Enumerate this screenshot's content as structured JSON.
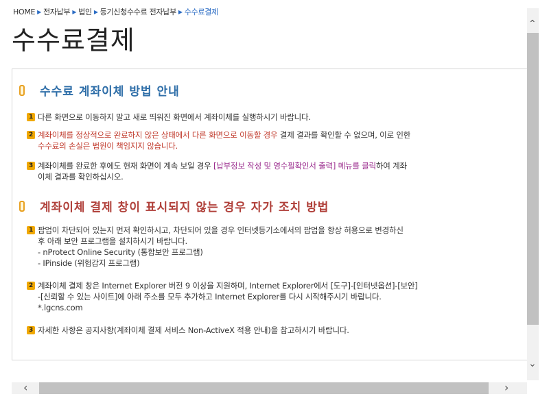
{
  "breadcrumb": {
    "items": [
      "HOME",
      "전자납부",
      "법인",
      "등기신청수수료 전자납부"
    ],
    "current": "수수료결제"
  },
  "page_title": "수수료결제",
  "section1": {
    "heading": "수수료 계좌이체 방법 안내",
    "items": [
      {
        "num": "1",
        "text": "다른 화면으로 이동하지 말고 새로 띄워진 화면에서 계좌이체를 실행하시기 바랍니다."
      },
      {
        "num": "2",
        "red": "계좌이체를 정상적으로 완료하지 않은 상태에서 다른 화면으로 이동할 경우",
        "text_mid": " 결제 결과를 확인할 수 없으며, 이로 인한",
        "red2": "수수료의 손실은 법원이 책임지지 않습니다."
      },
      {
        "num": "3",
        "text_pre": "계좌이체를 완료한 후에도 현재 화면이 계속 보일 경우 ",
        "purple": "[납부정보 작성 및 영수필확인서 출력] 메뉴를 클릭",
        "text_post": "하여 계좌",
        "text_line2": "이체 결과를 확인하십시오."
      }
    ]
  },
  "section2": {
    "heading": "계좌이체 결제 창이 표시되지 않는 경우 자가 조치 방법",
    "items": [
      {
        "num": "1",
        "text": "팝업이 차단되어 있는지 먼저 확인하시고, 차단되어 있을 경우 인터넷등기소에서의 팝업을 항상 허용으로 변경하신\n후 아래 보안 프로그램을 설치하시기 바랍니다.\n- nProtect Online Security (통합보안 프로그램)\n- IPinside (위험감지 프로그램)"
      },
      {
        "num": "2",
        "text": "계좌이체 결제 창은 Internet Explorer 버전 9 이상을 지원하며, Internet Explorer에서 [도구]-[인터넷옵션]-[보안]\n-[신뢰할 수 있는 사이트]에 아래 주소를 모두 추가하고 Internet Explorer를 다시 시작해주시기 바랍니다.\n*.lgcns.com"
      },
      {
        "num": "3",
        "text": "자세한 사항은 공지사항(계좌이체 결제 서비스 Non-ActiveX 적용 안내)을 참고하시기 바랍니다."
      }
    ]
  }
}
